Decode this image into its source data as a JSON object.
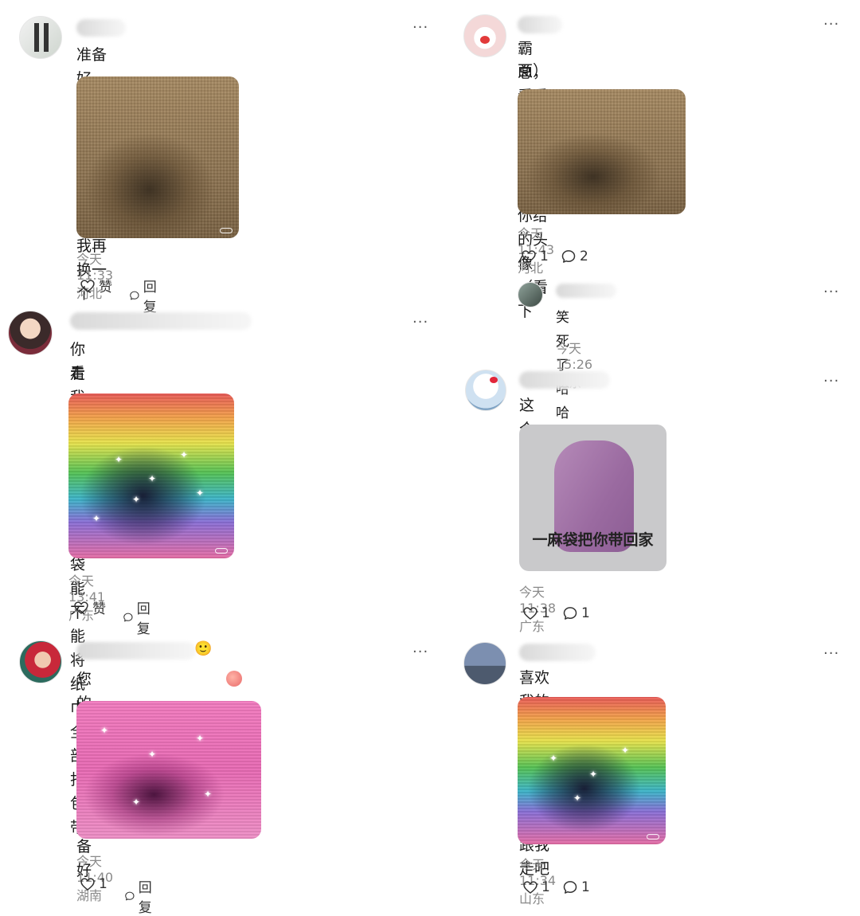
{
  "left": [
    {
      "text": "准备好了，这个大小合适不，不行我再换一个",
      "meta": "今天 11:33 河北",
      "like": "赞",
      "reply": "回复"
    },
    {
      "text_line1": "你看我这七彩的麻包袋能不能将纸巾全部打包带",
      "text_line2": "走",
      "meta": "今天 13:41 广东",
      "like": "赞",
      "reply": "回复"
    },
    {
      "text": "您的粉色麻袋已备好",
      "meta": "今天 11:40 湖南",
      "like": "1",
      "reply": "回复"
    }
  ],
  "right": [
    {
      "text_line1": "霸总，看看我，我还一直用着你给的头像（看下",
      "text_line2": "面）",
      "meta": "今天 11:43 河北",
      "like": "1",
      "reply": "2",
      "sub_reply": {
        "text": "笑死了哈哈哈",
        "meta": "今天 15:26 广东"
      }
    },
    {
      "text": "这个麻袋够装吗",
      "image_caption": "一麻袋把你带回家",
      "meta": "今天 11:38 广东",
      "like": "1",
      "reply": "1"
    },
    {
      "text": "喜欢我的七彩麻袋吗，霸总，跟我走吧",
      "meta": "今天 11:34 山东",
      "like": "1",
      "reply": "1"
    }
  ],
  "more_label": "···",
  "icons": {
    "like": "heart-icon",
    "reply": "speech-bubble-icon",
    "more": "more-dots-icon"
  }
}
